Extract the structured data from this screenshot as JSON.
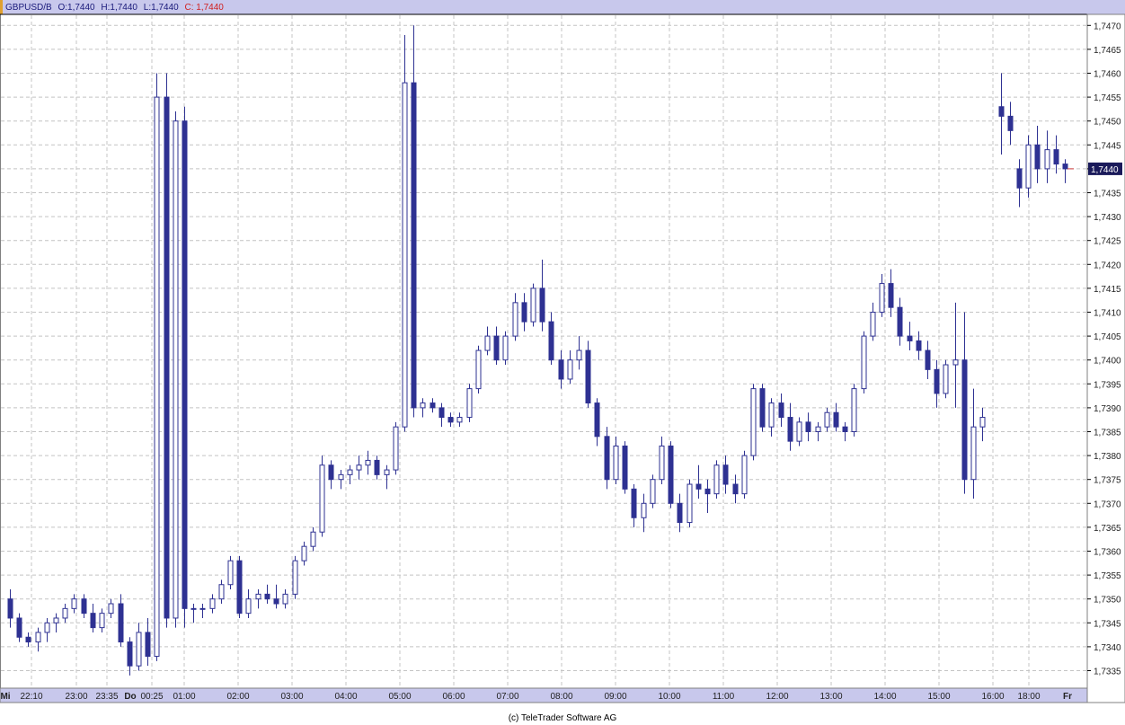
{
  "header": {
    "symbol": "GBPUSD/B",
    "open": "O:1,7440",
    "high": "H:1,7440",
    "low": "L:1,7440",
    "close": "C: 1,7440"
  },
  "copyright": "(c) TeleTrader Software AG",
  "colors": {
    "header_bg": "#c8c8ec",
    "axis_bg": "#c8c8ec",
    "candle": "#2e3192",
    "close_marker": "#d04040",
    "last_price_bg": "#1a1a5a",
    "grid": "#c4c4c4"
  },
  "chart_data": {
    "type": "candlestick",
    "title": "",
    "ylim": [
      1.7332,
      1.7472
    ],
    "y_ticks": [
      "1,7335",
      "1,7340",
      "1,7345",
      "1,7350",
      "1,7355",
      "1,7360",
      "1,7365",
      "1,7370",
      "1,7375",
      "1,7380",
      "1,7385",
      "1,7390",
      "1,7395",
      "1,7400",
      "1,7405",
      "1,7410",
      "1,7415",
      "1,7420",
      "1,7425",
      "1,7430",
      "1,7435",
      "1,7440",
      "1,7445",
      "1,7450",
      "1,7455",
      "1,7460",
      "1,7465",
      "1,7470"
    ],
    "x_ticks": [
      "Mi",
      "22:10",
      "23:00",
      "23:35",
      "Do",
      "00:25",
      "01:00",
      "02:00",
      "03:00",
      "04:00",
      "05:00",
      "06:00",
      "07:00",
      "08:00",
      "09:00",
      "10:00",
      "11:00",
      "12:00",
      "13:00",
      "14:00",
      "15:00",
      "16:00",
      "18:00",
      "Fr"
    ],
    "last_price": "1,7440",
    "candles": [
      [
        1.735,
        1.7352,
        1.7344,
        1.7346
      ],
      [
        1.7346,
        1.7347,
        1.7341,
        1.7342
      ],
      [
        1.7342,
        1.7343,
        1.734,
        1.7341
      ],
      [
        1.7341,
        1.7344,
        1.7339,
        1.7343
      ],
      [
        1.7343,
        1.7346,
        1.7341,
        1.7345
      ],
      [
        1.7345,
        1.7347,
        1.7343,
        1.7346
      ],
      [
        1.7346,
        1.7349,
        1.7345,
        1.7348
      ],
      [
        1.7348,
        1.7351,
        1.7347,
        1.735
      ],
      [
        1.735,
        1.7351,
        1.7346,
        1.7347
      ],
      [
        1.7347,
        1.7349,
        1.7343,
        1.7344
      ],
      [
        1.7344,
        1.7348,
        1.7343,
        1.7347
      ],
      [
        1.7347,
        1.735,
        1.7346,
        1.7349
      ],
      [
        1.7349,
        1.7351,
        1.734,
        1.7341
      ],
      [
        1.7341,
        1.7342,
        1.7334,
        1.7336
      ],
      [
        1.7336,
        1.7345,
        1.7335,
        1.7343
      ],
      [
        1.7343,
        1.7346,
        1.7336,
        1.7338
      ],
      [
        1.7338,
        1.746,
        1.7337,
        1.7455
      ],
      [
        1.7455,
        1.746,
        1.7344,
        1.7346
      ],
      [
        1.7346,
        1.7452,
        1.7344,
        1.745
      ],
      [
        1.745,
        1.7453,
        1.7344,
        1.7348
      ],
      [
        1.7348,
        1.7349,
        1.7345,
        1.7348
      ],
      [
        1.7348,
        1.7349,
        1.7346,
        1.7348
      ],
      [
        1.7348,
        1.7351,
        1.7347,
        1.735
      ],
      [
        1.735,
        1.7354,
        1.7349,
        1.7353
      ],
      [
        1.7353,
        1.7359,
        1.7352,
        1.7358
      ],
      [
        1.7358,
        1.7359,
        1.7346,
        1.7347
      ],
      [
        1.7347,
        1.7352,
        1.7346,
        1.735
      ],
      [
        1.735,
        1.7352,
        1.7348,
        1.7351
      ],
      [
        1.7351,
        1.7353,
        1.7349,
        1.735
      ],
      [
        1.735,
        1.7353,
        1.7348,
        1.7349
      ],
      [
        1.7349,
        1.7352,
        1.7348,
        1.7351
      ],
      [
        1.7351,
        1.7359,
        1.735,
        1.7358
      ],
      [
        1.7358,
        1.7362,
        1.7357,
        1.7361
      ],
      [
        1.7361,
        1.7365,
        1.736,
        1.7364
      ],
      [
        1.7364,
        1.738,
        1.7363,
        1.7378
      ],
      [
        1.7378,
        1.7379,
        1.7373,
        1.7375
      ],
      [
        1.7375,
        1.7377,
        1.7373,
        1.7376
      ],
      [
        1.7376,
        1.7378,
        1.7374,
        1.7377
      ],
      [
        1.7377,
        1.738,
        1.7375,
        1.7378
      ],
      [
        1.7378,
        1.7381,
        1.7376,
        1.7379
      ],
      [
        1.7379,
        1.738,
        1.7375,
        1.7376
      ],
      [
        1.7376,
        1.7378,
        1.7373,
        1.7377
      ],
      [
        1.7377,
        1.7387,
        1.7376,
        1.7386
      ],
      [
        1.7386,
        1.7468,
        1.7385,
        1.7458
      ],
      [
        1.7458,
        1.747,
        1.7388,
        1.739
      ],
      [
        1.739,
        1.7392,
        1.7388,
        1.7391
      ],
      [
        1.7391,
        1.7392,
        1.7389,
        1.739
      ],
      [
        1.739,
        1.7391,
        1.7386,
        1.7388
      ],
      [
        1.7388,
        1.7389,
        1.7386,
        1.7387
      ],
      [
        1.7387,
        1.7389,
        1.7386,
        1.7388
      ],
      [
        1.7388,
        1.7395,
        1.7387,
        1.7394
      ],
      [
        1.7394,
        1.7403,
        1.7393,
        1.7402
      ],
      [
        1.7402,
        1.7407,
        1.7401,
        1.7405
      ],
      [
        1.7405,
        1.7407,
        1.7399,
        1.74
      ],
      [
        1.74,
        1.7406,
        1.7399,
        1.7405
      ],
      [
        1.7405,
        1.7414,
        1.7404,
        1.7412
      ],
      [
        1.7412,
        1.7414,
        1.7406,
        1.7408
      ],
      [
        1.7408,
        1.7416,
        1.7407,
        1.7415
      ],
      [
        1.7415,
        1.7421,
        1.7406,
        1.7408
      ],
      [
        1.7408,
        1.741,
        1.7399,
        1.74
      ],
      [
        1.74,
        1.7402,
        1.7394,
        1.7396
      ],
      [
        1.7396,
        1.7402,
        1.7395,
        1.74
      ],
      [
        1.74,
        1.7405,
        1.7398,
        1.7402
      ],
      [
        1.7402,
        1.7404,
        1.739,
        1.7391
      ],
      [
        1.7391,
        1.7392,
        1.7382,
        1.7384
      ],
      [
        1.7384,
        1.7386,
        1.7373,
        1.7375
      ],
      [
        1.7375,
        1.7384,
        1.7374,
        1.7382
      ],
      [
        1.7382,
        1.7383,
        1.7372,
        1.7373
      ],
      [
        1.7373,
        1.7374,
        1.7365,
        1.7367
      ],
      [
        1.7367,
        1.7372,
        1.7364,
        1.737
      ],
      [
        1.737,
        1.7376,
        1.7369,
        1.7375
      ],
      [
        1.7375,
        1.7384,
        1.7374,
        1.7382
      ],
      [
        1.7382,
        1.7383,
        1.7369,
        1.737
      ],
      [
        1.737,
        1.7372,
        1.7364,
        1.7366
      ],
      [
        1.7366,
        1.7375,
        1.7365,
        1.7374
      ],
      [
        1.7374,
        1.7378,
        1.7371,
        1.7373
      ],
      [
        1.7373,
        1.7375,
        1.7368,
        1.7372
      ],
      [
        1.7372,
        1.7379,
        1.7371,
        1.7378
      ],
      [
        1.7378,
        1.738,
        1.7372,
        1.7374
      ],
      [
        1.7374,
        1.7376,
        1.737,
        1.7372
      ],
      [
        1.7372,
        1.7381,
        1.7371,
        1.738
      ],
      [
        1.738,
        1.7395,
        1.7379,
        1.7394
      ],
      [
        1.7394,
        1.7395,
        1.7385,
        1.7386
      ],
      [
        1.7386,
        1.7392,
        1.7384,
        1.7391
      ],
      [
        1.7391,
        1.7393,
        1.7386,
        1.7388
      ],
      [
        1.7388,
        1.7391,
        1.7381,
        1.7383
      ],
      [
        1.7383,
        1.7388,
        1.7382,
        1.7387
      ],
      [
        1.7387,
        1.7389,
        1.7383,
        1.7385
      ],
      [
        1.7385,
        1.7387,
        1.7383,
        1.7386
      ],
      [
        1.7386,
        1.739,
        1.7385,
        1.7389
      ],
      [
        1.7389,
        1.7391,
        1.7385,
        1.7386
      ],
      [
        1.7386,
        1.7387,
        1.7383,
        1.7385
      ],
      [
        1.7385,
        1.7395,
        1.7384,
        1.7394
      ],
      [
        1.7394,
        1.7406,
        1.7393,
        1.7405
      ],
      [
        1.7405,
        1.7412,
        1.7404,
        1.741
      ],
      [
        1.741,
        1.7418,
        1.7409,
        1.7416
      ],
      [
        1.7416,
        1.7419,
        1.7409,
        1.7411
      ],
      [
        1.7411,
        1.7413,
        1.7403,
        1.7405
      ],
      [
        1.7405,
        1.7408,
        1.7402,
        1.7404
      ],
      [
        1.7404,
        1.7406,
        1.74,
        1.7402
      ],
      [
        1.7402,
        1.7404,
        1.7396,
        1.7398
      ],
      [
        1.7398,
        1.74,
        1.739,
        1.7393
      ],
      [
        1.7393,
        1.74,
        1.7392,
        1.7399
      ],
      [
        1.7399,
        1.7412,
        1.739,
        1.74
      ],
      [
        1.74,
        1.741,
        1.7372,
        1.7375
      ],
      [
        1.7375,
        1.7394,
        1.7371,
        1.7386
      ],
      [
        1.7386,
        1.739,
        1.7383,
        1.7388
      ],
      [
        1.7453,
        1.746,
        1.7443,
        1.7451
      ],
      [
        1.7451,
        1.7454,
        1.7445,
        1.7448
      ],
      [
        1.744,
        1.7442,
        1.7432,
        1.7436
      ],
      [
        1.7436,
        1.7447,
        1.7434,
        1.7445
      ],
      [
        1.7445,
        1.7449,
        1.7437,
        1.744
      ],
      [
        1.744,
        1.7448,
        1.7437,
        1.7444
      ],
      [
        1.7444,
        1.7447,
        1.7439,
        1.7441
      ],
      [
        1.7441,
        1.7442,
        1.7437,
        1.744
      ]
    ]
  }
}
